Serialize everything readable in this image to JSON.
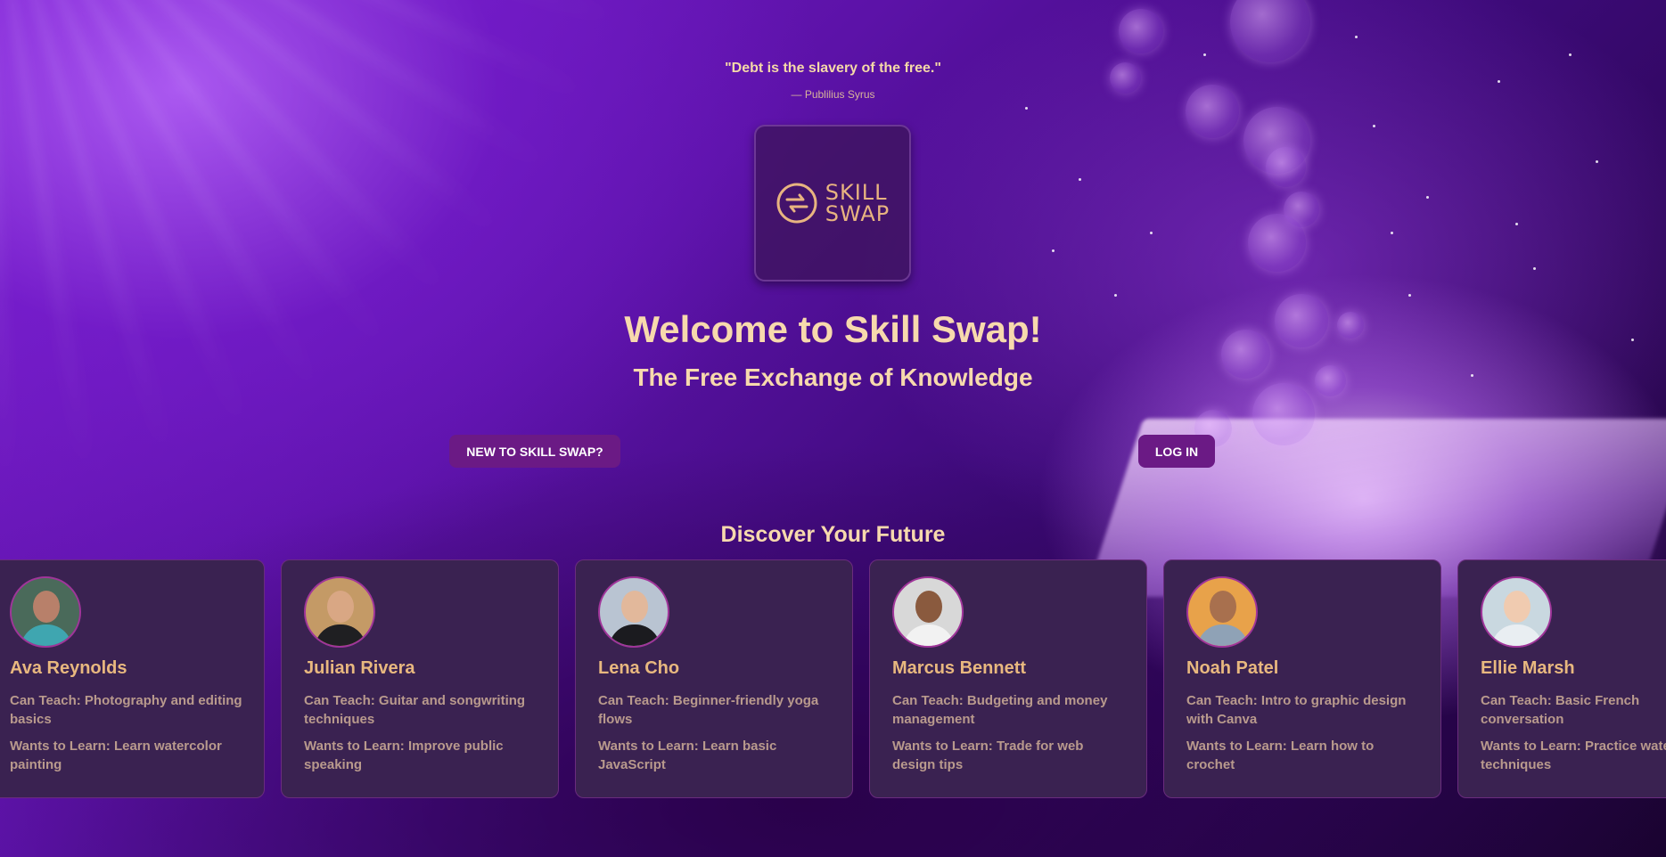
{
  "header": {
    "quote": "\"Debt is the slavery of the free.\"",
    "quote_author": "— Publilius Syrus"
  },
  "logo": {
    "line1": "SKILL",
    "line2": "SWAP",
    "icon": "swap-arrows-icon"
  },
  "hero": {
    "title": "Welcome to Skill Swap!",
    "subtitle": "The Free Exchange of Knowledge"
  },
  "actions": {
    "new_label": "NEW TO SKILL SWAP?",
    "login_label": "LOG IN"
  },
  "discover": {
    "heading": "Discover Your Future",
    "cards": [
      {
        "name": "Ava Reynolds",
        "teach": "Can Teach: Photography and editing basics",
        "learn": "Wants to Learn: Learn watercolor painting"
      },
      {
        "name": "Julian Rivera",
        "teach": "Can Teach: Guitar and songwriting techniques",
        "learn": "Wants to Learn: Improve public speaking"
      },
      {
        "name": "Lena Cho",
        "teach": "Can Teach: Beginner-friendly yoga flows",
        "learn": "Wants to Learn: Learn basic JavaScript"
      },
      {
        "name": "Marcus Bennett",
        "teach": "Can Teach: Budgeting and money management",
        "learn": "Wants to Learn: Trade for web design tips"
      },
      {
        "name": "Noah Patel",
        "teach": "Can Teach: Intro to graphic design with Canva",
        "learn": "Wants to Learn: Learn how to crochet"
      },
      {
        "name": "Ellie Marsh",
        "teach": "Can Teach: Basic French conversation",
        "learn": "Wants to Learn: Practice watercolor techniques"
      }
    ]
  },
  "colors": {
    "accent": "#6b1a85",
    "card_bg": "#3a2251",
    "heading": "#f7d9ad"
  }
}
